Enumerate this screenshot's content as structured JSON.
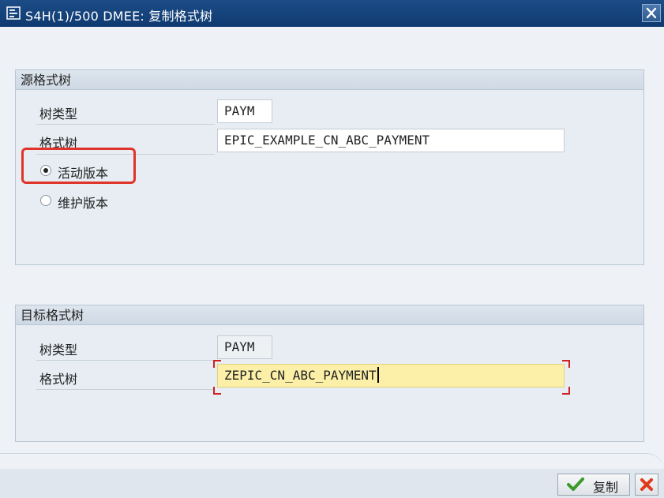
{
  "window": {
    "title": "S4H(1)/500 DMEE: 复制格式树"
  },
  "source": {
    "header": "源格式树",
    "tree_type_label": "树类型",
    "tree_type_value": "PAYM",
    "format_tree_label": "格式树",
    "format_tree_value": "EPIC_EXAMPLE_CN_ABC_PAYMENT",
    "radio_active_label": "活动版本",
    "radio_maintenance_label": "维护版本",
    "selected_version": "活动版本"
  },
  "target": {
    "header": "目标格式树",
    "tree_type_label": "树类型",
    "tree_type_value": "PAYM",
    "format_tree_label": "格式树",
    "format_tree_value": "ZEPIC_CN_ABC_PAYMENT"
  },
  "footer": {
    "copy_label": "复制"
  },
  "icons": {
    "title": "window-icon",
    "close": "close-icon",
    "copy": "checkmark-icon",
    "cancel": "cancel-icon"
  },
  "colors": {
    "titlebar": "#0e3a70",
    "active_field": "#fcf0a8",
    "highlight": "#e0342a",
    "check": "#3b9a2a",
    "cancel": "#e03a1a"
  }
}
